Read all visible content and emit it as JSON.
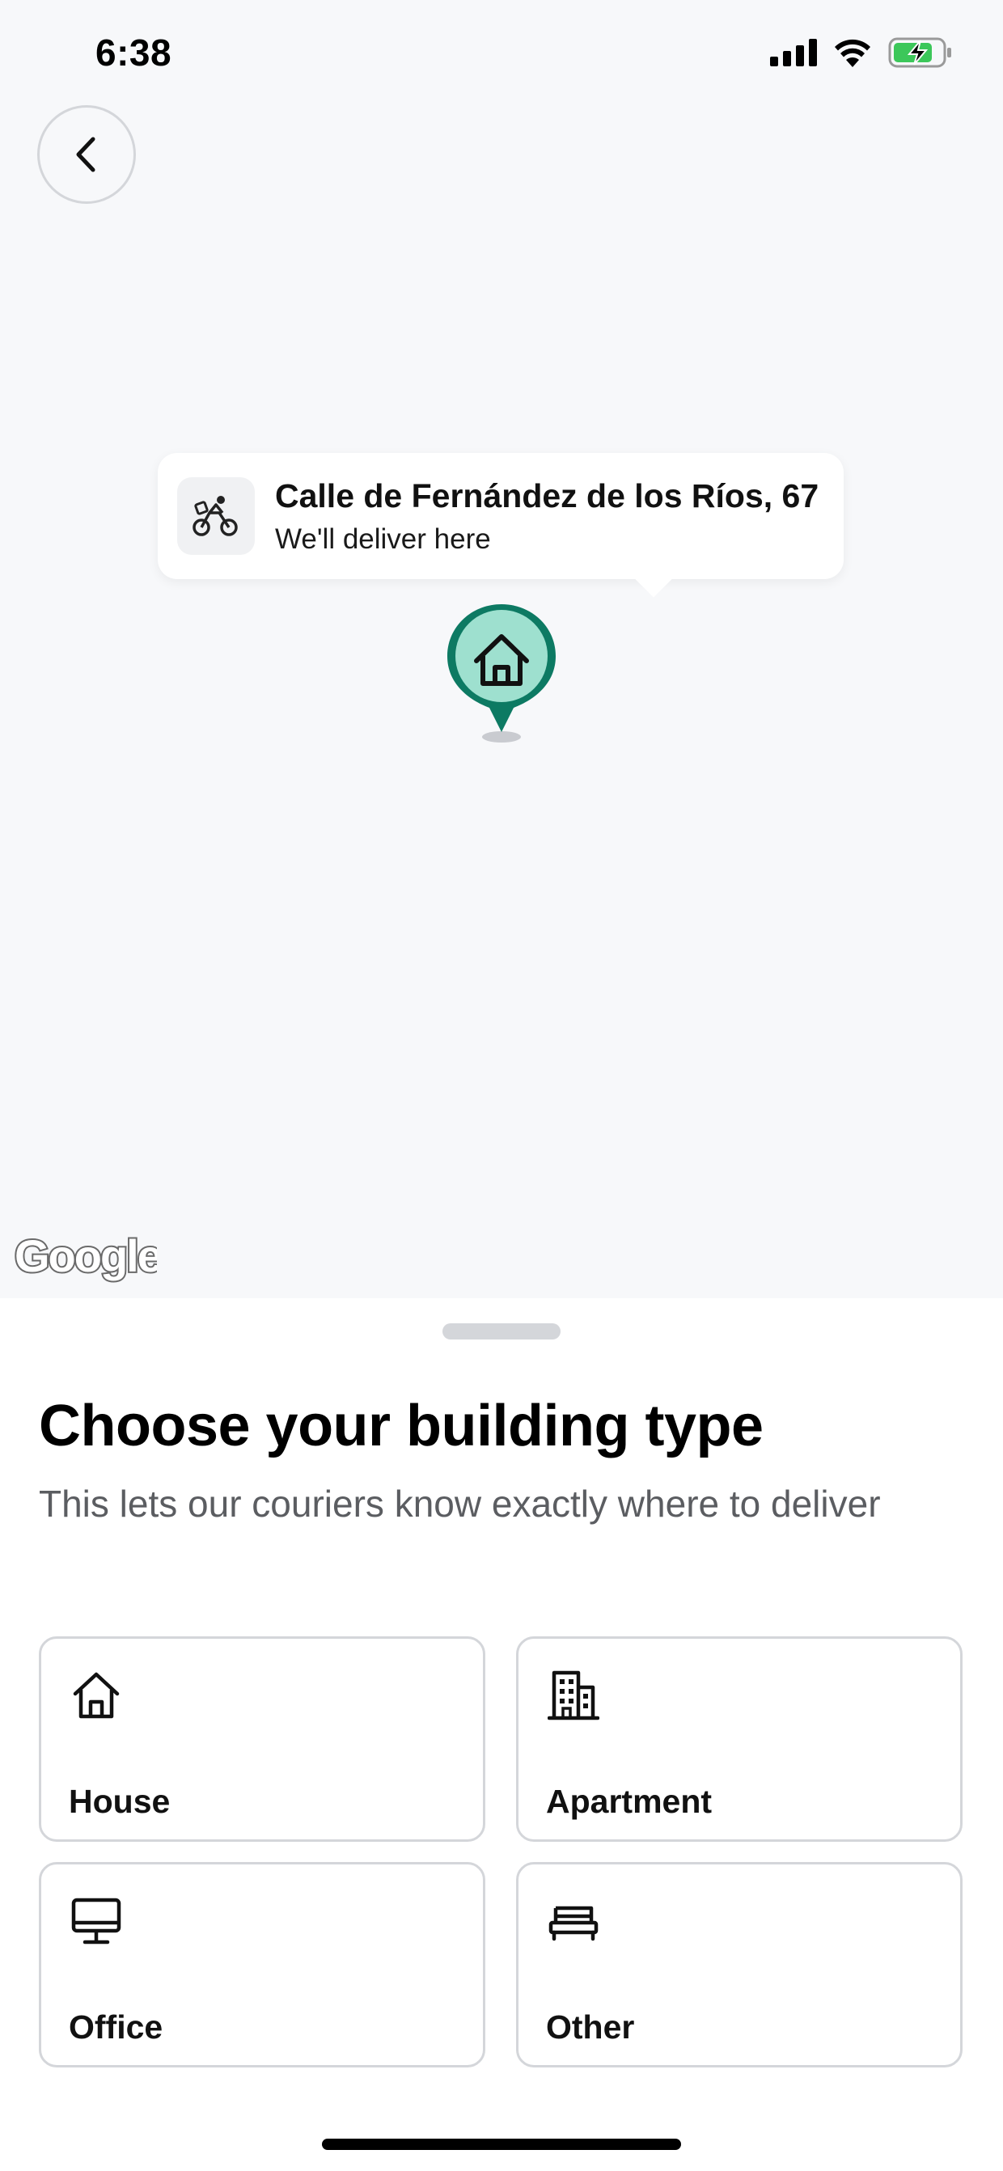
{
  "status_bar": {
    "time": "6:38",
    "icons": [
      "signal-icon",
      "wifi-icon",
      "battery-charging-icon"
    ],
    "battery_color": "#3cc75a"
  },
  "map": {
    "back_icon": "chevron-left-icon",
    "address_card": {
      "icon": "courier-bike-icon",
      "title": "Calle de Fernández de los Ríos, 67",
      "subtitle": "We'll deliver here"
    },
    "pin": {
      "icon": "house-pin-icon",
      "color": "#0d7a63",
      "fill": "#9ee0cf"
    },
    "attribution": "Google"
  },
  "sheet": {
    "title": "Choose your building type",
    "subtitle": "This lets our couriers know exactly where to deliver",
    "options": [
      {
        "label": "House",
        "icon": "house-icon"
      },
      {
        "label": "Apartment",
        "icon": "apartment-building-icon"
      },
      {
        "label": "Office",
        "icon": "desktop-monitor-icon"
      },
      {
        "label": "Other",
        "icon": "bed-icon"
      }
    ]
  }
}
